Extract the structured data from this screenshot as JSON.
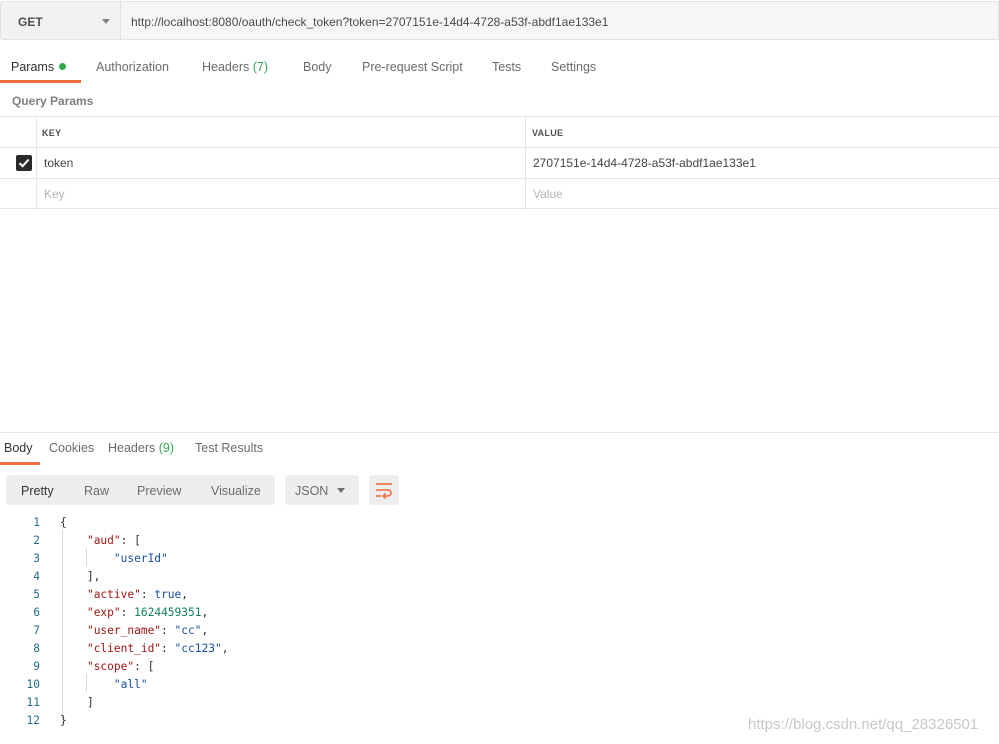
{
  "request": {
    "method": "GET",
    "url": "http://localhost:8080/oauth/check_token?token=2707151e-14d4-4728-a53f-abdf1ae133e1"
  },
  "request_tabs": {
    "params": "Params",
    "authorization": "Authorization",
    "headers": "Headers",
    "headers_count": "(7)",
    "body": "Body",
    "prerequest": "Pre-request Script",
    "tests": "Tests",
    "settings": "Settings"
  },
  "query_params": {
    "title": "Query Params",
    "key_header": "KEY",
    "value_header": "VALUE",
    "rows": [
      {
        "key": "token",
        "value": "2707151e-14d4-4728-a53f-abdf1ae133e1",
        "checked": true
      }
    ],
    "key_placeholder": "Key",
    "value_placeholder": "Value"
  },
  "response_tabs": {
    "body": "Body",
    "cookies": "Cookies",
    "headers": "Headers",
    "headers_count": "(9)",
    "test_results": "Test Results"
  },
  "view_modes": {
    "pretty": "Pretty",
    "raw": "Raw",
    "preview": "Preview",
    "visualize": "Visualize",
    "format": "JSON",
    "wrap_icon": "wrap-lines-icon"
  },
  "code": {
    "line_numbers": [
      "1",
      "2",
      "3",
      "4",
      "5",
      "6",
      "7",
      "8",
      "9",
      "10",
      "11",
      "12"
    ],
    "lines": [
      "{",
      "    \"aud\": [",
      "        \"userId\"",
      "    ],",
      "    \"active\": true,",
      "    \"exp\": 1624459351,",
      "    \"user_name\": \"cc\",",
      "    \"client_id\": \"cc123\",",
      "    \"scope\": [",
      "        \"all\"",
      "    ]",
      "}"
    ]
  },
  "watermark": "https://blog.csdn.net/qq_28326501",
  "colors": {
    "accent": "#f26b3a",
    "success": "#2fa84f",
    "json_key": "#a31515",
    "json_string": "#1a4fa0",
    "json_number": "#0b7f5f"
  }
}
